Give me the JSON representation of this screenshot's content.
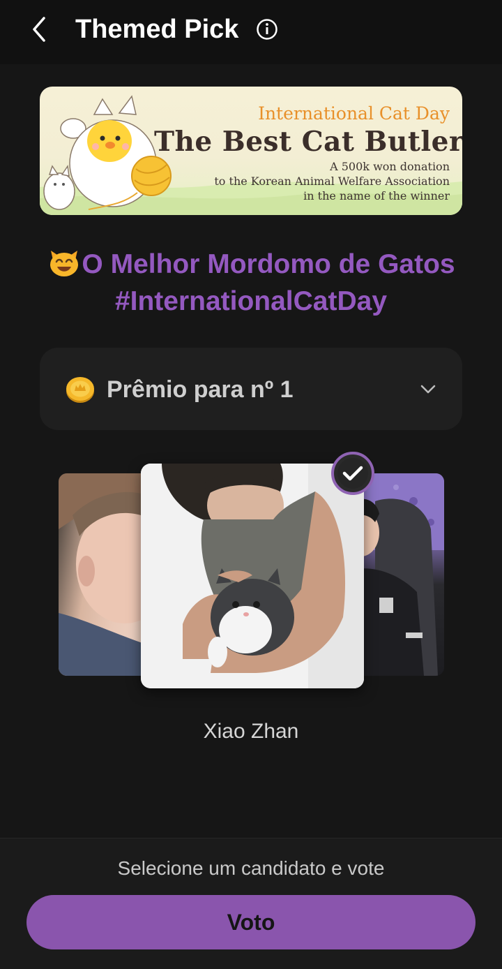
{
  "header": {
    "title": "Themed Pick",
    "back_icon": "chevron-left-icon",
    "info_icon": "info-circle-icon"
  },
  "banner": {
    "event": "International Cat Day",
    "headline": "The Best Cat Butler",
    "description_lines": [
      "A 500k won donation",
      "to the Korean Animal Welfare Association",
      "in the name of the winner"
    ]
  },
  "theme": {
    "emoji": "smiling-cat-face-icon",
    "title": "O Melhor Mordomo de Gatos #InternationalCatDay",
    "color": "#9459c0"
  },
  "prize": {
    "icon": "gold-coin-icon",
    "label": "Prêmio para nº 1",
    "dropdown_icon": "chevron-down-icon"
  },
  "candidates": {
    "selected_name": "Xiao Zhan",
    "selected_icon": "check-circle-icon"
  },
  "footer": {
    "hint": "Selecione um candidato e vote",
    "vote_label": "Voto",
    "accent": "#8a55ad"
  }
}
